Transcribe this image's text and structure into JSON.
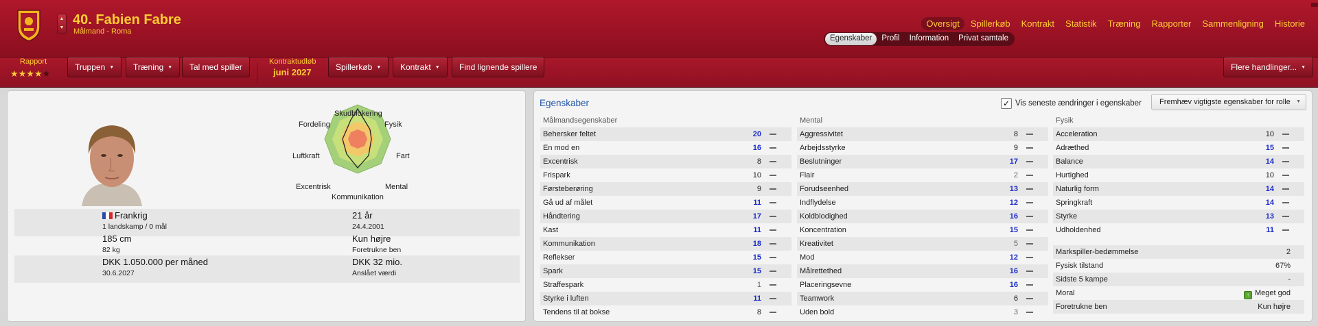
{
  "header": {
    "title": "40. Fabien Fabre",
    "subtitle": "Målmand - Roma",
    "nav": [
      "Oversigt",
      "Spillerkøb",
      "Kontrakt",
      "Statistik",
      "Træning",
      "Rapporter",
      "Sammenligning",
      "Historie"
    ],
    "nav_active": "Oversigt",
    "subtabs": [
      "Egenskaber",
      "Profil",
      "Information",
      "Privat samtale"
    ],
    "subtab_active": "Egenskaber"
  },
  "toolbar": {
    "rapport_label": "Rapport",
    "rating": 4,
    "rating_max": 5,
    "buttons": {
      "truppen": "Truppen",
      "traening": "Træning",
      "tal_med_spiller": "Tal med spiller",
      "spillerkoeb": "Spillerkøb",
      "kontrakt": "Kontrakt",
      "find_lignende": "Find lignende spillere",
      "flere_handlinger": "Flere handlinger..."
    },
    "kontraktudloeb_label": "Kontraktudløb",
    "kontraktudloeb_value": "juni 2027"
  },
  "radar": {
    "labels": {
      "skudblokering": "Skudblokering",
      "fordeling": "Fordeling",
      "fysik": "Fysik",
      "luftkraft": "Luftkraft",
      "fart": "Fart",
      "excentrisk": "Excentrisk",
      "mental": "Mental",
      "kommunikation": "Kommunikation"
    }
  },
  "info": {
    "nationality": "Frankrig",
    "caps": "1 landskamp / 0 mål",
    "age": "21 år",
    "birthdate": "24.4.2001",
    "height": "185 cm",
    "weight": "82 kg",
    "foot": "Kun højre",
    "foot_label": "Foretrukne ben",
    "wage": "DKK 1.050.000 per måned",
    "contract_end": "30.6.2027",
    "value": "DKK 32 mio.",
    "value_label": "Anslået værdi"
  },
  "attributes": {
    "title": "Egenskaber",
    "show_changes_label": "Vis seneste ændringer i egenskaber",
    "show_changes_checked": true,
    "highlight_label": "Fremhæv vigtigste egenskaber for rolle",
    "goalkeeping_head": "Målmandsegenskaber",
    "mental_head": "Mental",
    "physical_head": "Fysik",
    "goalkeeping": [
      {
        "name": "Behersker feltet",
        "value": "20"
      },
      {
        "name": "En mod en",
        "value": "16"
      },
      {
        "name": "Excentrisk",
        "value": "8"
      },
      {
        "name": "Frispark",
        "value": "10"
      },
      {
        "name": "Førsteberøring",
        "value": "9"
      },
      {
        "name": "Gå ud af målet",
        "value": "11"
      },
      {
        "name": "Håndtering",
        "value": "17"
      },
      {
        "name": "Kast",
        "value": "11"
      },
      {
        "name": "Kommunikation",
        "value": "18"
      },
      {
        "name": "Reflekser",
        "value": "15"
      },
      {
        "name": "Spark",
        "value": "15"
      },
      {
        "name": "Straffespark",
        "value": "1"
      },
      {
        "name": "Styrke i luften",
        "value": "11"
      },
      {
        "name": "Tendens til at bokse",
        "value": "8"
      }
    ],
    "mental": [
      {
        "name": "Aggressivitet",
        "value": "8"
      },
      {
        "name": "Arbejdsstyrke",
        "value": "9"
      },
      {
        "name": "Beslutninger",
        "value": "17"
      },
      {
        "name": "Flair",
        "value": "2"
      },
      {
        "name": "Forudseenhed",
        "value": "13"
      },
      {
        "name": "Indflydelse",
        "value": "12"
      },
      {
        "name": "Koldblodighed",
        "value": "16"
      },
      {
        "name": "Koncentration",
        "value": "15"
      },
      {
        "name": "Kreativitet",
        "value": "5"
      },
      {
        "name": "Mod",
        "value": "12"
      },
      {
        "name": "Målrettethed",
        "value": "16"
      },
      {
        "name": "Placeringsevne",
        "value": "16"
      },
      {
        "name": "Teamwork",
        "value": "6"
      },
      {
        "name": "Uden bold",
        "value": "3"
      }
    ],
    "physical": [
      {
        "name": "Acceleration",
        "value": "10"
      },
      {
        "name": "Adræthed",
        "value": "15"
      },
      {
        "name": "Balance",
        "value": "14"
      },
      {
        "name": "Hurtighed",
        "value": "10"
      },
      {
        "name": "Naturlig form",
        "value": "14"
      },
      {
        "name": "Springkraft",
        "value": "14"
      },
      {
        "name": "Styrke",
        "value": "13"
      },
      {
        "name": "Udholdenhed",
        "value": "11"
      }
    ],
    "extra": [
      {
        "name": "Markspiller-bedømmelse",
        "value": "2"
      },
      {
        "name": "Fysisk tilstand",
        "value": "67%"
      },
      {
        "name": "Sidste 5 kampe",
        "value": "-"
      },
      {
        "name": "Moral",
        "value": "Meget god"
      },
      {
        "name": "Foretrukne ben",
        "value": "Kun højre"
      }
    ]
  },
  "colors": {
    "header_red": "#9a1224",
    "gold": "#ffcc33",
    "strong_value": "#1a2bc9",
    "section_title": "#2257a6"
  }
}
